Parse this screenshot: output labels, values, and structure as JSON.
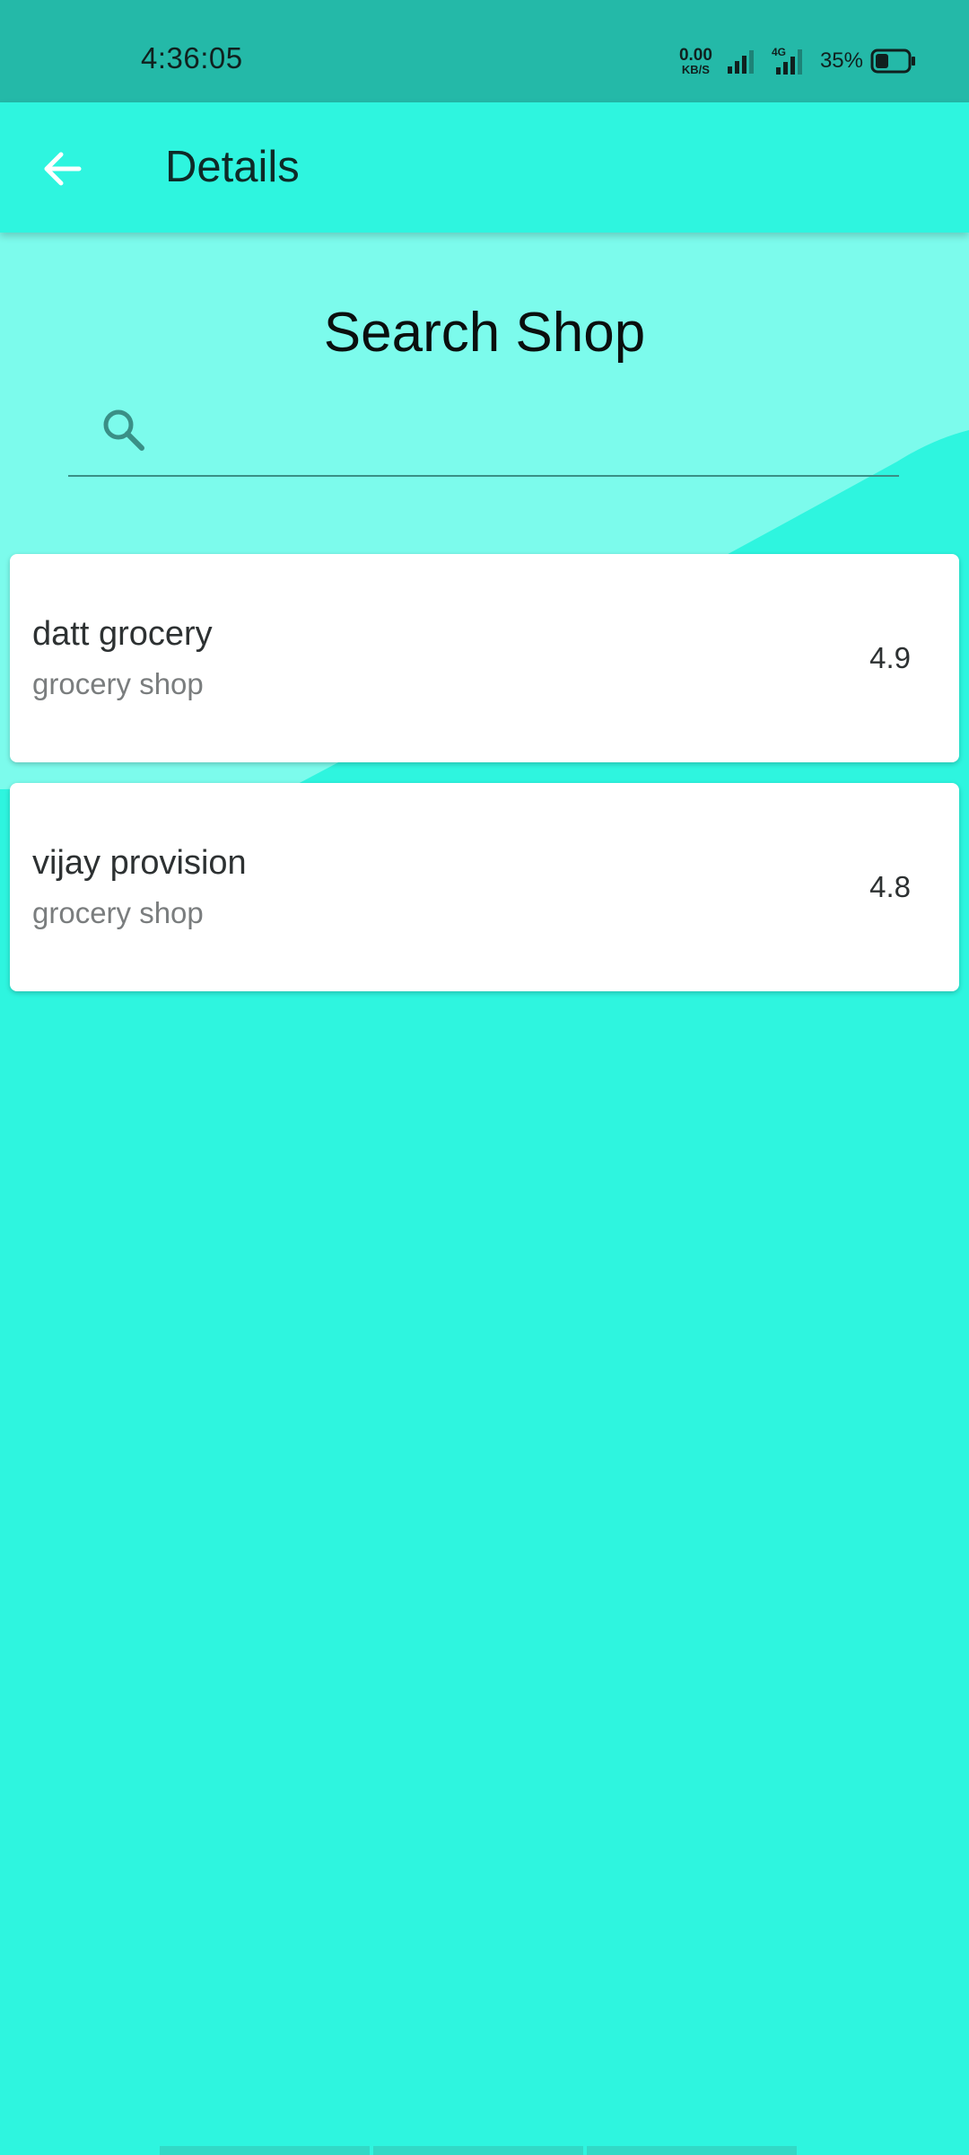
{
  "status_bar": {
    "time": "4:36:05",
    "net_speed_value": "0.00",
    "net_speed_unit": "KB/S",
    "network_type": "4G",
    "battery_percent": "35%",
    "battery_level": 0.35
  },
  "app_bar": {
    "title": "Details",
    "back_icon": "arrow-left-icon"
  },
  "search": {
    "title": "Search Shop",
    "icon": "search-icon",
    "value": "",
    "placeholder": ""
  },
  "shops": [
    {
      "name": "datt grocery",
      "category": "grocery shop",
      "rating": "4.9"
    },
    {
      "name": "vijay provision",
      "category": "grocery shop",
      "rating": "4.8"
    }
  ],
  "colors": {
    "status_bar_bg": "#24b9a8",
    "primary": "#2ef5df",
    "light_wave": "#7cfbec",
    "card_bg": "#ffffff",
    "accent_line": "#3a8f86"
  }
}
